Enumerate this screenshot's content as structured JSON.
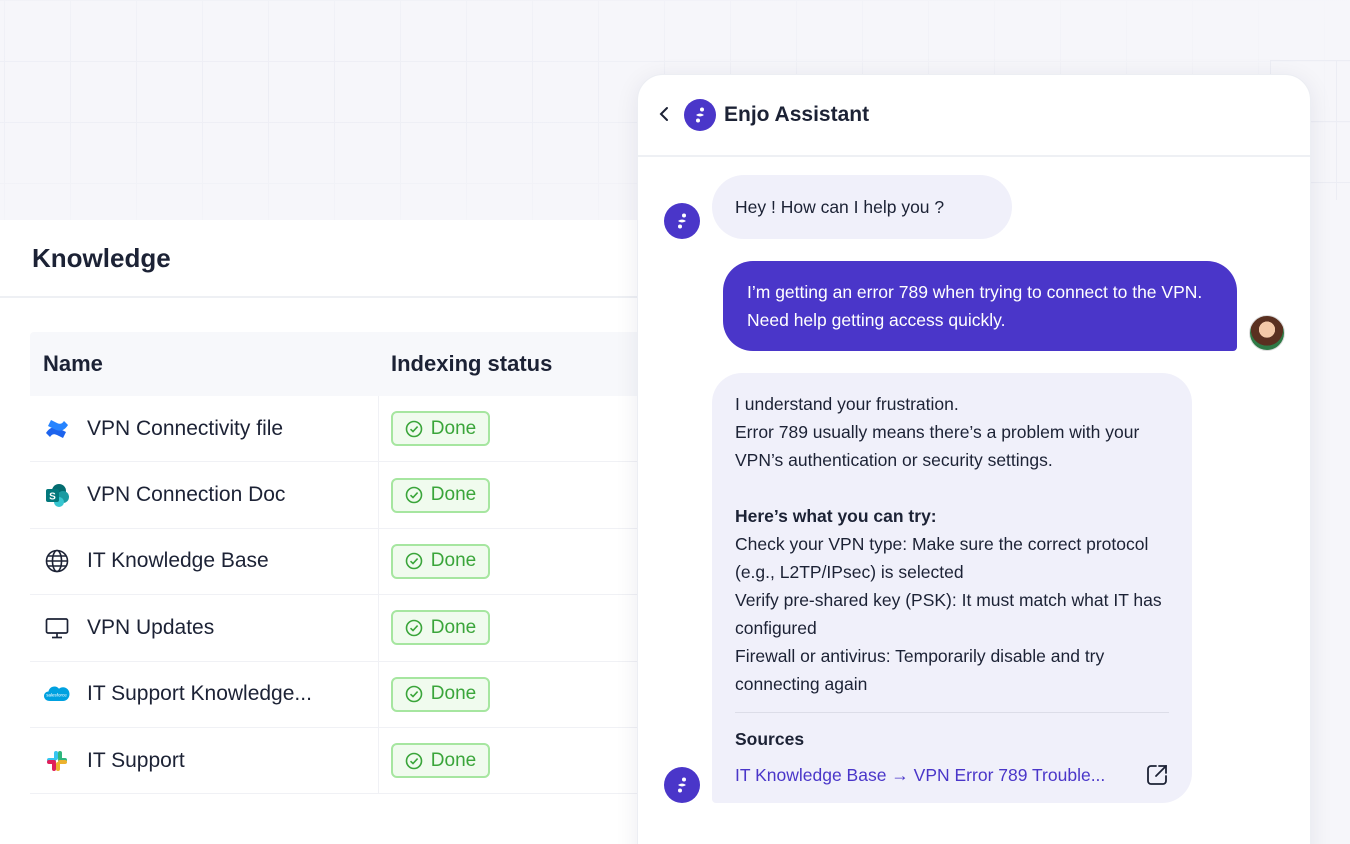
{
  "knowledge": {
    "title": "Knowledge",
    "columns": {
      "name": "Name",
      "status": "Indexing status"
    },
    "rows": [
      {
        "name": "VPN Connectivity file",
        "status": "Done",
        "icon": "confluence-icon"
      },
      {
        "name": "VPN Connection Doc",
        "status": "Done",
        "icon": "sharepoint-icon"
      },
      {
        "name": "IT Knowledge Base",
        "status": "Done",
        "icon": "globe-icon"
      },
      {
        "name": "VPN Updates",
        "status": "Done",
        "icon": "monitor-icon"
      },
      {
        "name": "IT Support Knowledge...",
        "status": "Done",
        "icon": "salesforce-icon"
      },
      {
        "name": "IT Support",
        "status": "Done",
        "icon": "slack-icon"
      }
    ]
  },
  "chat": {
    "title": "Enjo Assistant",
    "greeting": "Hey ! How can I help you ?",
    "user_message": "I’m getting an error 789 when trying to connect to the VPN. Need help getting access quickly.",
    "reply": {
      "line1": "I understand your frustration.",
      "line2": "Error 789 usually means there’s a problem with your VPN’s authentication or security settings.",
      "tips_heading": "Here’s what you can try:",
      "tip1": "Check your VPN type: Make sure the correct protocol (e.g., L2TP/IPsec) is selected",
      "tip2": "Verify pre-shared key (PSK): It must match what IT has configured",
      "tip3": "Firewall or antivirus: Temporarily disable and try connecting again",
      "sources_heading": "Sources",
      "source_link": "IT Knowledge Base → VPN Error 789 Trouble..."
    }
  },
  "colors": {
    "accent": "#4a36c9",
    "done_green": "#3aa53a",
    "bot_bubble": "#f0f0fa"
  }
}
